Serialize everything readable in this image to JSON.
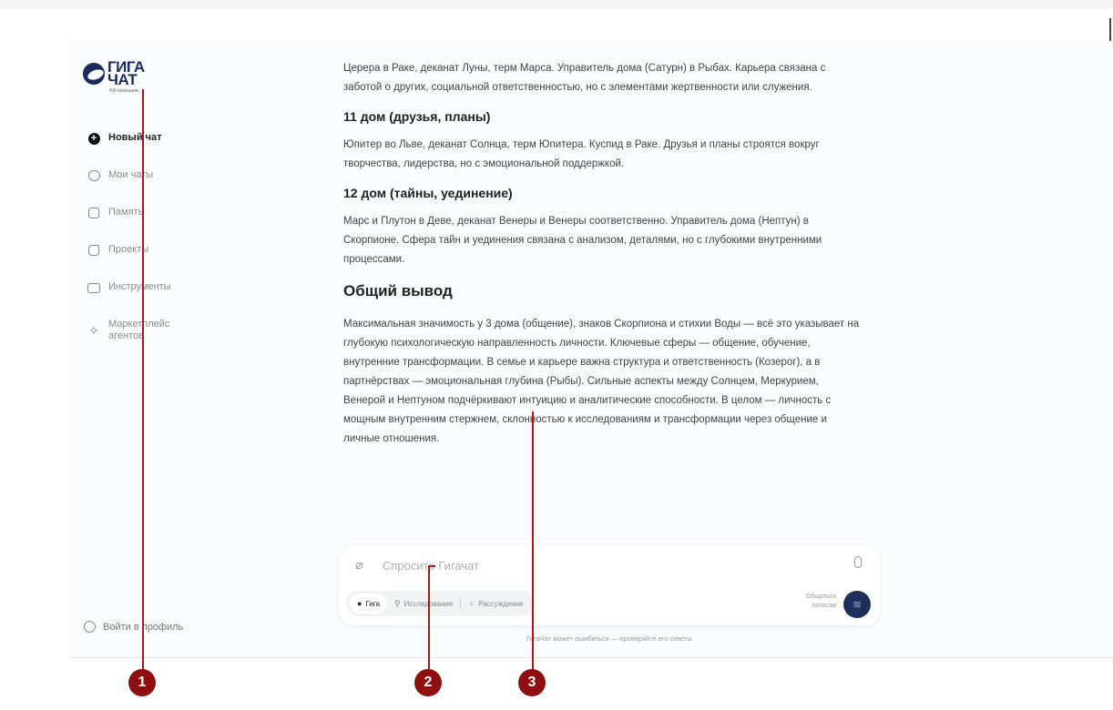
{
  "app": {
    "logo_text_line1": "ГИГА",
    "logo_text_line2": "ЧАТ",
    "logo_sub": "ИИ-помощник"
  },
  "sidebar": {
    "items": [
      {
        "label": "Новый чат",
        "icon": "plus-circle-icon"
      },
      {
        "label": "Мои чаты",
        "icon": "chats-icon"
      },
      {
        "label": "Память",
        "icon": "memory-icon"
      },
      {
        "label": "Проекты",
        "icon": "projects-icon"
      },
      {
        "label": "Инструменты",
        "icon": "tools-icon"
      },
      {
        "label": "Маркетплейс агентов",
        "icon": "sparkle-icon"
      }
    ],
    "login_label": "Войти в профиль"
  },
  "content": {
    "p_intro": "Церера в Раке, деканат Луны, терм Марса. Управитель дома (Сатурн) в Рыбах. Карьера связана с заботой о других, социальной ответственностью, но с элементами жертвенности или служения.",
    "h_11": "11 дом (друзья, планы)",
    "p_11": "Юпитер во Льве, деканат Солнца, терм Юпитера. Куспид в Раке. Друзья и планы строятся вокруг творчества, лидерства, но с эмоциональной поддержкой.",
    "h_12": "12 дом (тайны, уединение)",
    "p_12": "Марс и Плутон в Деве, деканат Венеры и Венеры соответственно. Управитель дома (Нептун) в Скорпионе. Сфера тайн и уединения связана с анализом, деталями, но с глубокими внутренними процессами.",
    "h_summary": "Общий вывод",
    "p_summary": "Максимальная значимость у 3 дома (общение), знаков Скорпиона и стихии Воды — всё это указывает на глубокую психологическую направленность личности. Ключевые сферы — общение, обучение, внутренние трансформации. В семье и карьере важна структура и ответственность (Козерог), а в партнёрствах — эмоциональная глубина (Рыбы). Сильные аспекты между Солнцем, Меркурием, Венерой и Нептуном подчёркивают интуицию и аналитические способности. В целом — личность с мощным внутренним стержнем, склонностью к исследованиям и трансформации через общение и личные отношения."
  },
  "composer": {
    "placeholder": "Спросите Гигачат",
    "modes": [
      {
        "label": "Гига",
        "active": true
      },
      {
        "label": "Исследование",
        "active": false
      },
      {
        "label": "Рассуждение",
        "active": false
      }
    ],
    "voice_label_1": "Общаться",
    "voice_label_2": "голосом"
  },
  "disclaimer": "ГигаЧат может ошибаться — проверяйте его ответы",
  "callouts": [
    "1",
    "2",
    "3"
  ],
  "colors": {
    "brand": "#1b2a5e",
    "callout": "#8e0f0f"
  }
}
